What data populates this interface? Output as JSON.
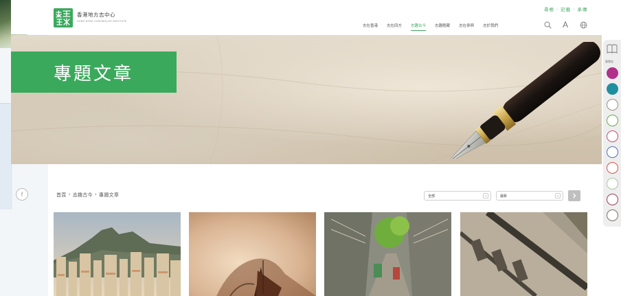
{
  "header": {
    "logo_cn": "香港地方志中心",
    "logo_en": "HONG KONG CHRONICLES INSTITUTE",
    "tagline": "尋根 · 記載 · 承傳",
    "nav": [
      {
        "label": "志在香港",
        "active": false
      },
      {
        "label": "志在四方",
        "active": false
      },
      {
        "label": "志趣古今",
        "active": true
      },
      {
        "label": "志趣館藏",
        "active": false
      },
      {
        "label": "志在參與",
        "active": false
      },
      {
        "label": "志於我們",
        "active": false
      }
    ],
    "icons": [
      "search-icon",
      "font-size-icon",
      "language-globe-icon"
    ],
    "font_size_label": "A"
  },
  "hero": {
    "title": "專題文章"
  },
  "sidebar": {
    "label": "香港志",
    "colors": [
      "#b0308a",
      "#1f8fa0",
      "#9a8f7e",
      "#6ea64b",
      "#c04d73",
      "#4f6fb0",
      "#d9544a",
      "#a9c6a2",
      "#9b3f5b",
      "#7a6f66"
    ]
  },
  "social": {
    "facebook_label": "f"
  },
  "breadcrumb": {
    "items": [
      "首頁",
      "志趣古今",
      "專題文章"
    ],
    "separator": "›"
  },
  "filters": {
    "category_value": "全部",
    "sort_value": "最新",
    "chevron": "⌄",
    "go_arrow": "›"
  },
  "colors": {
    "brand_green": "#3aa95c",
    "button_grey": "#bfbfbf"
  }
}
